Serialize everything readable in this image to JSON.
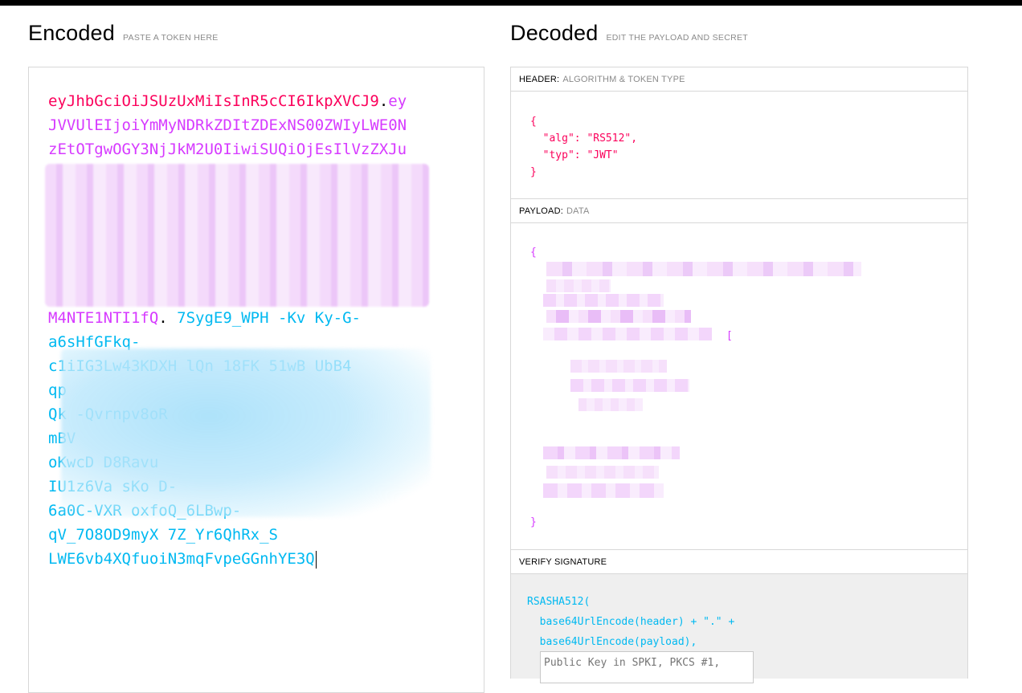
{
  "encoded": {
    "title": "Encoded",
    "subtitle": "PASTE A TOKEN HERE",
    "token_lines": [
      {
        "parts": [
          {
            "cls": "c-header",
            "text": "eyJhbGciOiJSUzUxMiIsInR5cCI6IkpXVCJ9"
          },
          {
            "cls": "c-dot",
            "text": "."
          },
          {
            "cls": "c-payload",
            "text": "ey"
          }
        ]
      },
      {
        "parts": [
          {
            "cls": "c-payload",
            "text": "JVVUlEIjoiYmMyNDRkZDItZDExNS00ZWIyLWE0N"
          }
        ]
      },
      {
        "parts": [
          {
            "cls": "c-payload",
            "text": "zEtOTgwOGY3NjJkM2U0IiwiSUQiOjEsIlVzZXJu"
          }
        ]
      },
      {
        "parts": [
          {
            "cls": "c-payload",
            "text": " "
          }
        ]
      },
      {
        "parts": [
          {
            "cls": "c-payload",
            "text": " "
          }
        ]
      },
      {
        "parts": [
          {
            "cls": "c-payload",
            "text": " "
          }
        ]
      },
      {
        "parts": [
          {
            "cls": "c-payload",
            "text": " "
          }
        ]
      },
      {
        "parts": [
          {
            "cls": "c-payload",
            "text": " "
          }
        ]
      },
      {
        "parts": [
          {
            "cls": "c-payload",
            "text": " "
          }
        ]
      },
      {
        "parts": [
          {
            "cls": "c-payload",
            "text": "M4NTE1NTI1fQ"
          },
          {
            "cls": "c-dot",
            "text": "."
          },
          {
            "cls": "c-sig",
            "text": "   7SygE9_WPH  -Kv    Ky-G-"
          }
        ]
      },
      {
        "parts": [
          {
            "cls": "c-sig",
            "text": "a6sHfGFkq-"
          }
        ]
      },
      {
        "parts": [
          {
            "cls": "c-sig",
            "text": "c1iIG3Lw43KDXH  lQn    18FK     51wB  UbB4"
          }
        ]
      },
      {
        "parts": [
          {
            "cls": "c-sig",
            "text": "qp"
          }
        ]
      },
      {
        "parts": [
          {
            "cls": "c-sig",
            "text": "Qk  -Qvrnpv8oR"
          }
        ]
      },
      {
        "parts": [
          {
            "cls": "c-sig",
            "text": "mBV"
          }
        ]
      },
      {
        "parts": [
          {
            "cls": "c-sig",
            "text": "oKwcD                             D8Ravu"
          }
        ]
      },
      {
        "parts": [
          {
            "cls": "c-sig",
            "text": "IU1z6Va  sKo                             D-"
          }
        ]
      },
      {
        "parts": [
          {
            "cls": "c-sig",
            "text": "6a0C-VXR      oxfoQ_6LBwp-"
          }
        ]
      },
      {
        "parts": [
          {
            "cls": "c-sig",
            "text": "qV_7O8OD9myX                    7Z_Yr6QhRx_S"
          }
        ]
      },
      {
        "parts": [
          {
            "cls": "c-sig",
            "text": "LWE6vb4XQfuoiN3mqFvpeGGnhYE3Q"
          }
        ]
      }
    ]
  },
  "decoded": {
    "title": "Decoded",
    "subtitle": "EDIT THE PAYLOAD AND SECRET",
    "header_label": "HEADER:",
    "header_hint": "ALGORITHM & TOKEN TYPE",
    "header_lines": [
      "{",
      "  \"alg\": \"RS512\",",
      "  \"typ\": \"JWT\"",
      "}"
    ],
    "payload_label": "PAYLOAD:",
    "payload_hint": "DATA",
    "payload_open": "{",
    "payload_close": "}",
    "payload_bracket": "[",
    "verify_label": "VERIFY SIGNATURE",
    "verify_lines": [
      "RSASHA512(",
      "  base64UrlEncode(header) + \".\" +",
      "  base64UrlEncode(payload),"
    ],
    "key_placeholder": "Public Key in SPKI, PKCS #1,"
  },
  "colors": {
    "header": "#fb015b",
    "payload": "#d63aff",
    "signature": "#00b9f1"
  }
}
